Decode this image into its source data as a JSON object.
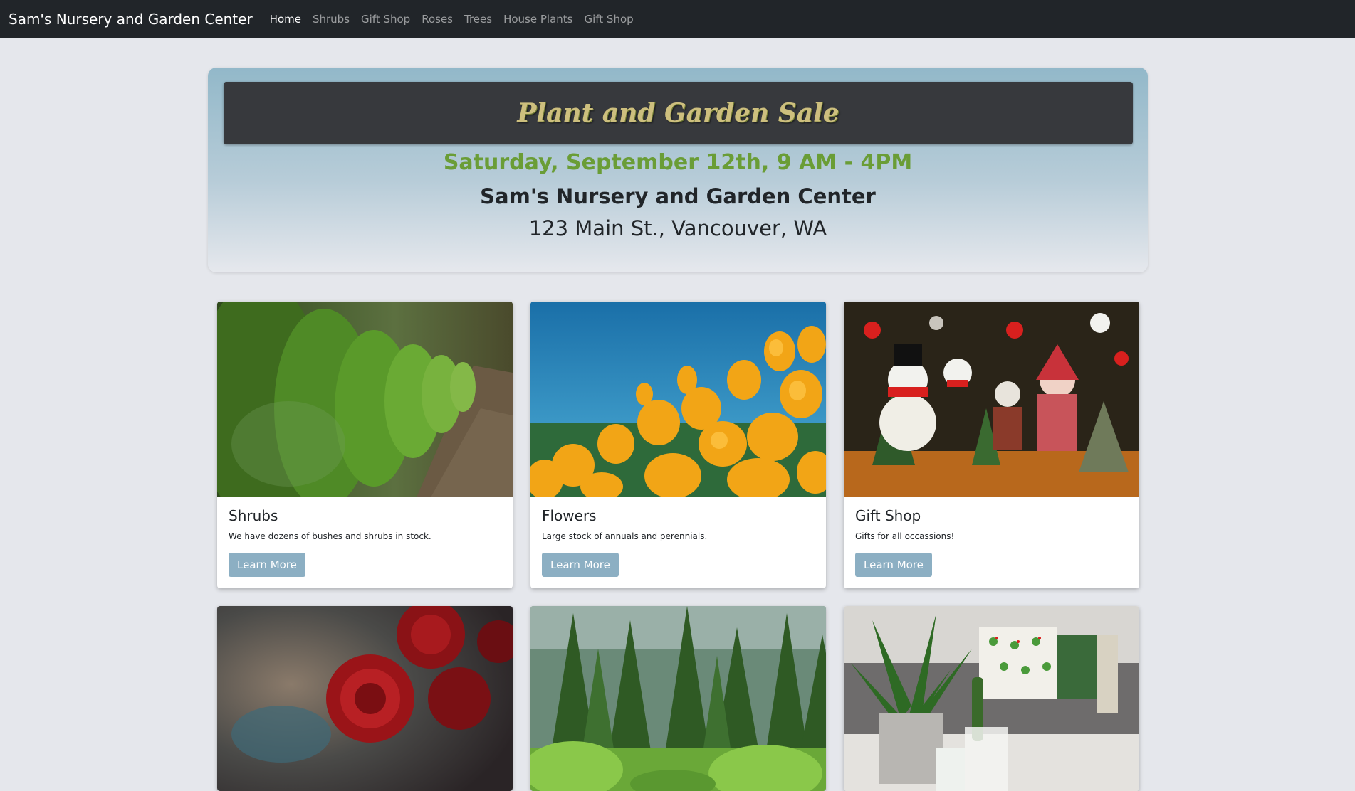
{
  "navbar": {
    "brand": "Sam's Nursery and Garden Center",
    "links": [
      {
        "label": "Home"
      },
      {
        "label": "Shrubs"
      },
      {
        "label": "Gift Shop"
      },
      {
        "label": "Roses"
      },
      {
        "label": "Trees"
      },
      {
        "label": "House Plants"
      },
      {
        "label": "Gift Shop"
      }
    ]
  },
  "hero": {
    "title": "Plant and Garden Sale",
    "date": "Saturday, September 12th, 9 AM - 4PM",
    "name": "Sam's Nursery and Garden Center",
    "address": "123 Main St., Vancouver, WA"
  },
  "cards": [
    {
      "title": "Shrubs",
      "text": "We have dozens of bushes and shrubs in stock.",
      "button": "Learn More"
    },
    {
      "title": "Flowers",
      "text": "Large stock of annuals and perennials.",
      "button": "Learn More"
    },
    {
      "title": "Gift Shop",
      "text": "Gifts for all occassions!",
      "button": "Learn More"
    }
  ],
  "colors": {
    "navbar": "#212529",
    "accent_green": "#6a9d36",
    "button": "#8cafc3",
    "title_gold": "#cdbf7e"
  }
}
